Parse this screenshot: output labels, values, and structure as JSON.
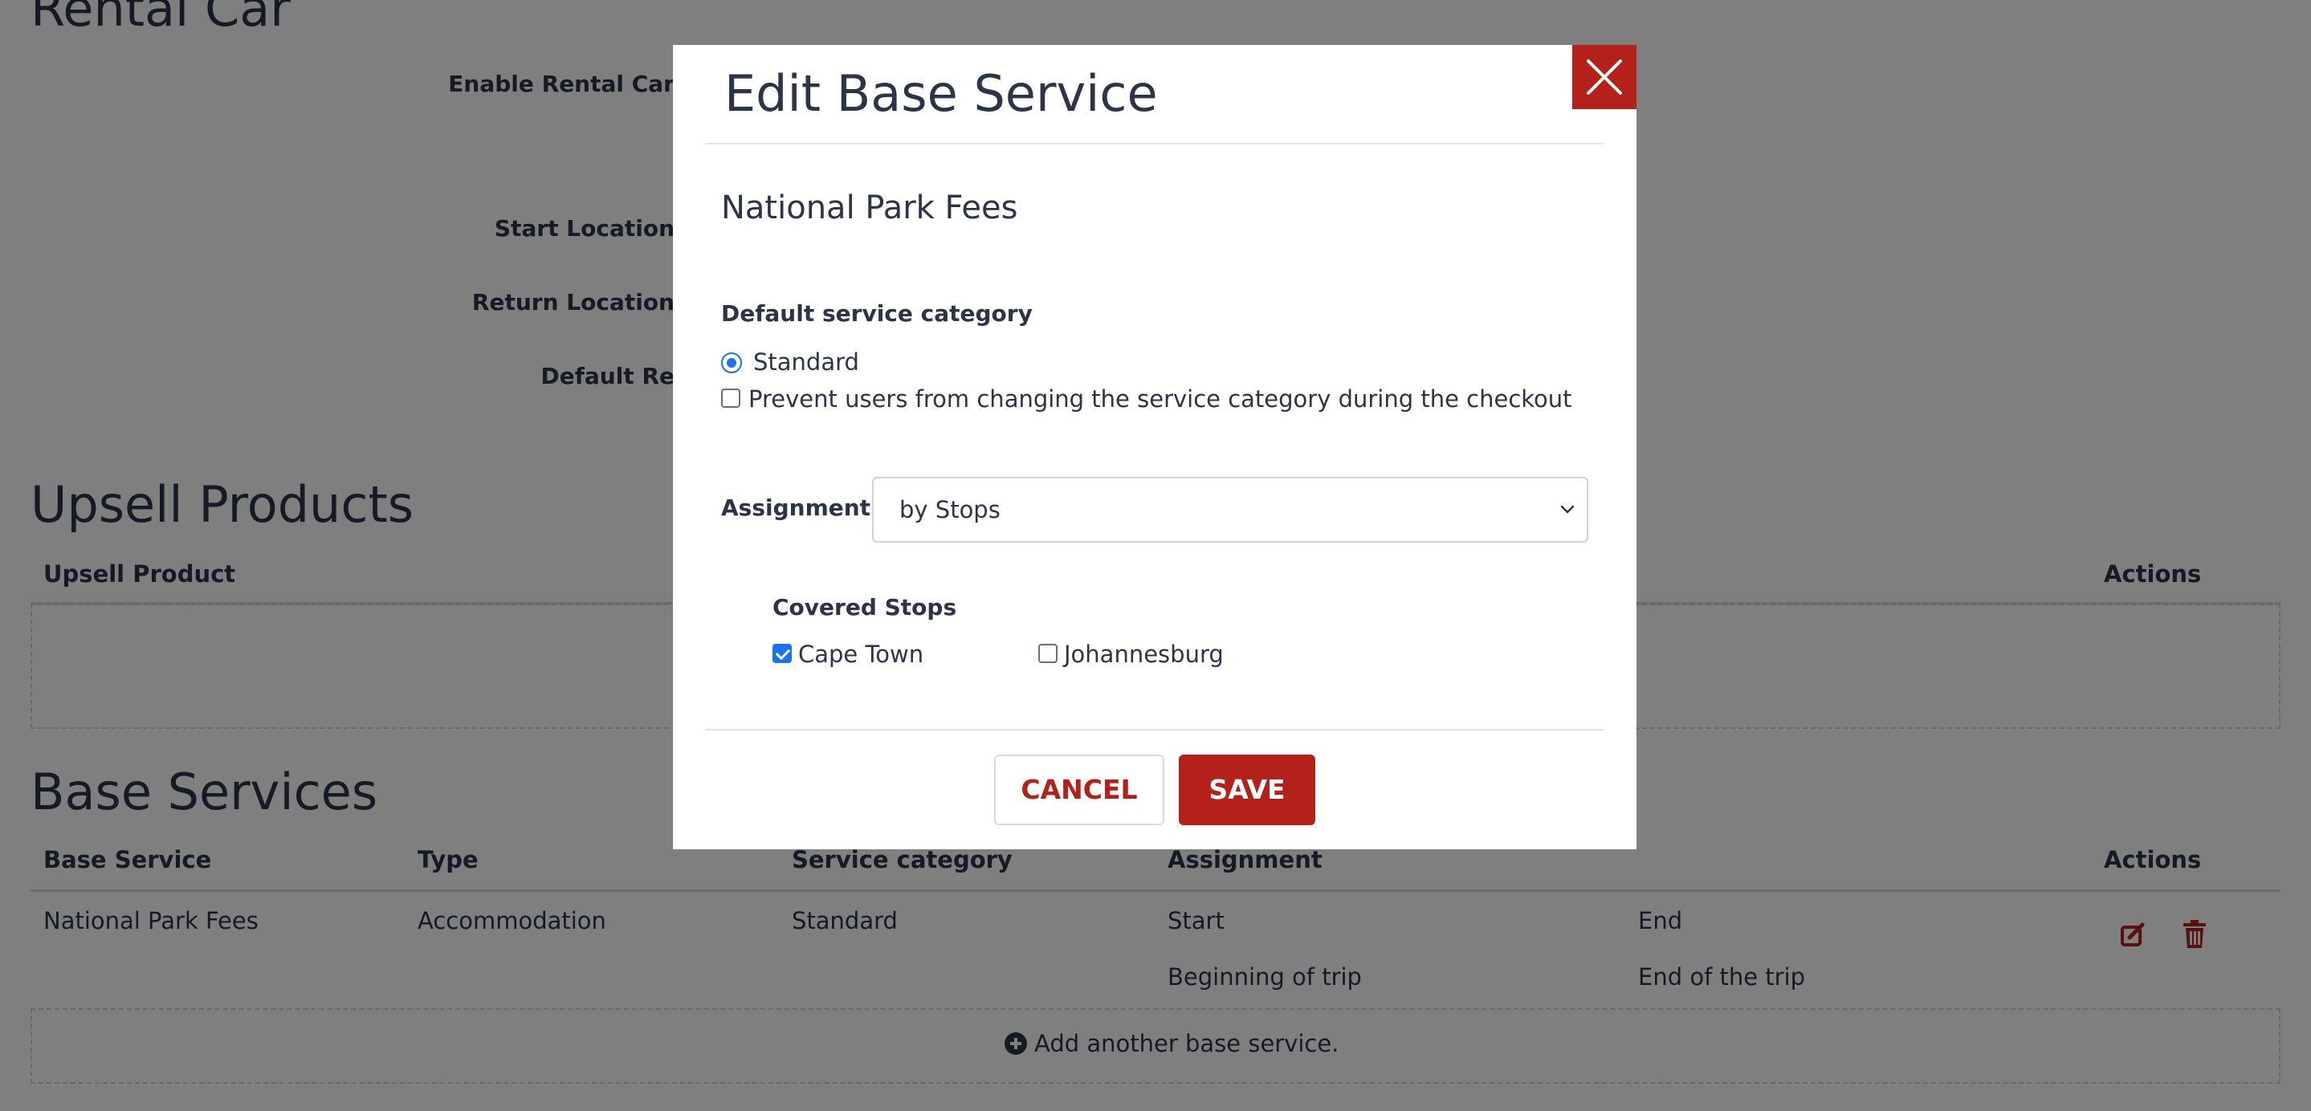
{
  "background": {
    "rental_car": {
      "section_title": "Rental Car",
      "enable_label": "Enable Rental Car",
      "start_location_label": "Start Location",
      "return_location_label": "Return Location",
      "default_label": "Default Re"
    },
    "upsell": {
      "section_title": "Upsell Products",
      "col_product": "Upsell Product",
      "col_actions": "Actions"
    },
    "base_services": {
      "section_title": "Base Services",
      "columns": {
        "base_service": "Base Service",
        "type": "Type",
        "service_category": "Service category",
        "assignment": "Assignment",
        "actions": "Actions"
      },
      "row": {
        "name": "National Park Fees",
        "type": "Accommodation",
        "category": "Standard",
        "start": "Start",
        "end": "End",
        "start_detail": "Beginning of trip",
        "end_detail": "End of the trip"
      },
      "add_link": "Add another base service."
    }
  },
  "modal": {
    "title": "Edit Base Service",
    "service_name": "National Park Fees",
    "category_label": "Default service category",
    "category_option": "Standard",
    "category_selected": true,
    "prevent_label": "Prevent users from changing the service category during the checkout",
    "prevent_checked": false,
    "assignment_label": "Assignment",
    "assignment_value": "by Stops",
    "covered_stops_label": "Covered Stops",
    "stops": [
      {
        "name": "Cape Town",
        "checked": true
      },
      {
        "name": "Johannesburg",
        "checked": false
      }
    ],
    "cancel_label": "CANCEL",
    "save_label": "SAVE"
  },
  "colors": {
    "accent_red": "#b3211a",
    "checkbox_blue": "#1a73e8",
    "text_dark": "#2c3448"
  },
  "icons": {
    "close": "close-icon",
    "edit": "edit-icon",
    "delete": "trash-icon",
    "add": "plus-circle-icon",
    "dropdown": "chevron-down-icon"
  }
}
